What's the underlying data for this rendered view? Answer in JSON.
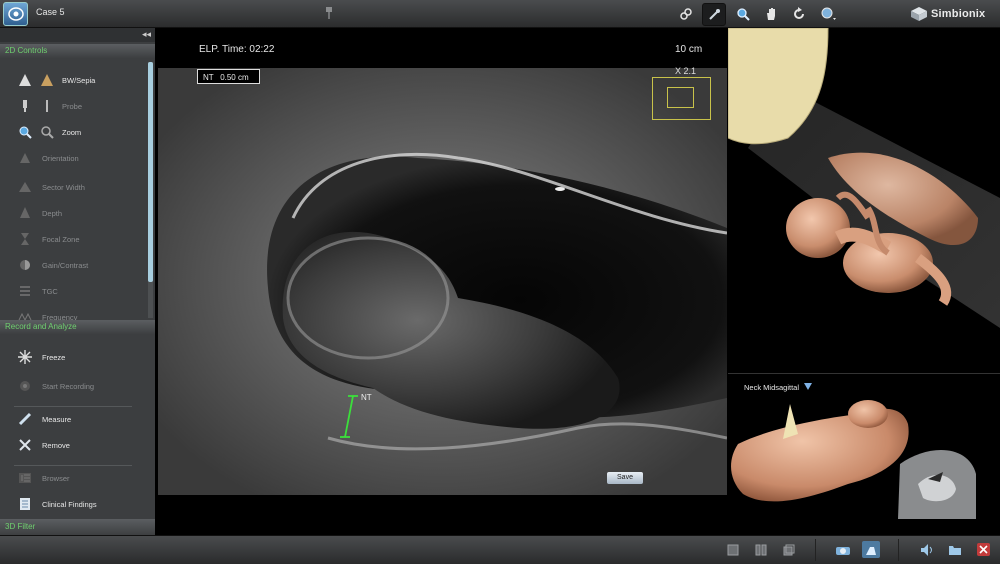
{
  "app": {
    "case_title": "Case 5",
    "brand": "Simbionix"
  },
  "toolbar": {
    "buttons": [
      {
        "name": "link-icon",
        "active": false
      },
      {
        "name": "probe-link-icon",
        "active": true
      },
      {
        "name": "zoom-icon",
        "active": false
      },
      {
        "name": "pan-hand-icon",
        "active": false
      },
      {
        "name": "rotate-icon",
        "active": false
      },
      {
        "name": "magnifier-dropdown-icon",
        "active": false
      }
    ]
  },
  "left_panel": {
    "collapse_label": "◂◂",
    "controls_header": "2D Controls",
    "controls": [
      {
        "label": "BW/Sepia",
        "enabled": true,
        "icon": "bw-sepia-icon"
      },
      {
        "label": "Probe",
        "enabled": false,
        "icon": "probe-icon"
      },
      {
        "label": "Zoom",
        "enabled": true,
        "icon": "zoom-icon"
      },
      {
        "label": "Orientation",
        "enabled": false,
        "icon": "orientation-icon"
      },
      {
        "label": "Sector Width",
        "enabled": false,
        "icon": "sector-width-icon"
      },
      {
        "label": "Depth",
        "enabled": false,
        "icon": "depth-icon"
      },
      {
        "label": "Focal Zone",
        "enabled": false,
        "icon": "focal-zone-icon"
      },
      {
        "label": "Gain/Contrast",
        "enabled": false,
        "icon": "gain-contrast-icon"
      },
      {
        "label": "TGC",
        "enabled": false,
        "icon": "tgc-icon"
      },
      {
        "label": "Frequency",
        "enabled": false,
        "icon": "frequency-icon"
      }
    ],
    "record_header": "Record and Analyze",
    "record_items": [
      {
        "label": "Freeze",
        "enabled": true,
        "icon": "freeze-icon"
      },
      {
        "label": "Start Recording",
        "enabled": false,
        "icon": "record-icon"
      },
      {
        "label": "Measure",
        "enabled": true,
        "icon": "measure-icon"
      },
      {
        "label": "Remove",
        "enabled": true,
        "icon": "remove-icon"
      },
      {
        "label": "Browser",
        "enabled": false,
        "icon": "browser-icon"
      },
      {
        "label": "Clinical Findings",
        "enabled": true,
        "icon": "clinical-findings-icon"
      }
    ],
    "filter_header": "3D Filter"
  },
  "main_view": {
    "elp_time": "ELP. Time: 02:22",
    "depth": "10 cm",
    "measurement": "NT   0.50 cm",
    "zoom_factor": "X 2.1",
    "nt_marker": "NT",
    "save_label": "Save"
  },
  "lower_view": {
    "plane_label": "Neck Midsagittal",
    "dropdown_icon": "triangle-down-icon"
  },
  "bottom_bar": {
    "buttons": [
      "layout-single-icon",
      "layout-split-icon",
      "layout-overlay-icon",
      "camera-view-icon",
      "probe-view-icon",
      "volume-icon",
      "folder-icon",
      "close-icon"
    ]
  },
  "colors": {
    "accent_green": "#6fd06f",
    "zoom_box": "#c8c24a",
    "measure_line": "#3be03b",
    "skin": "#d89a7a"
  }
}
